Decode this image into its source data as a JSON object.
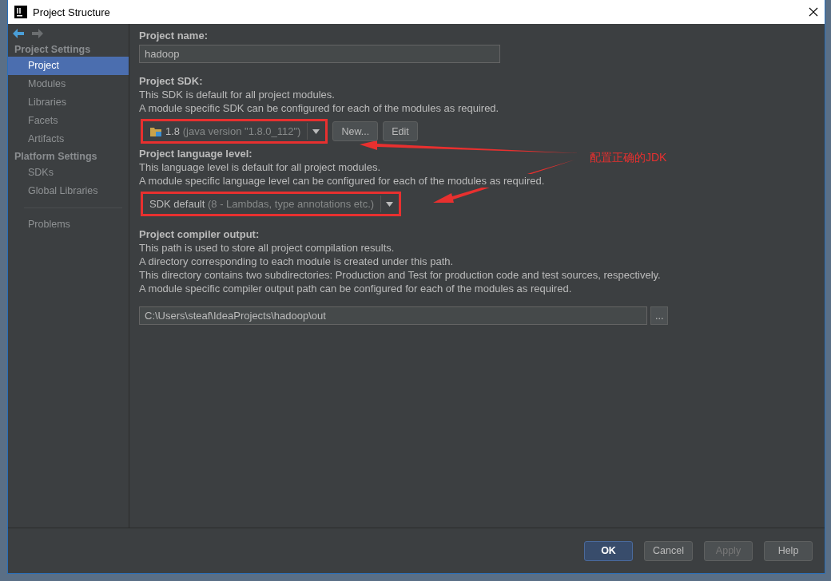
{
  "window": {
    "title": "Project Structure"
  },
  "sidebar": {
    "groups": [
      {
        "title": "Project Settings",
        "items": [
          {
            "label": "Project",
            "selected": true
          },
          {
            "label": "Modules",
            "selected": false
          },
          {
            "label": "Libraries",
            "selected": false
          },
          {
            "label": "Facets",
            "selected": false
          },
          {
            "label": "Artifacts",
            "selected": false
          }
        ]
      },
      {
        "title": "Platform Settings",
        "items": [
          {
            "label": "SDKs",
            "selected": false
          },
          {
            "label": "Global Libraries",
            "selected": false
          }
        ]
      }
    ],
    "extra_items": [
      {
        "label": "Problems",
        "selected": false
      }
    ]
  },
  "project_name": {
    "label": "Project name:",
    "value": "hadoop"
  },
  "project_sdk": {
    "label": "Project SDK:",
    "description": [
      "This SDK is default for all project modules.",
      "A module specific SDK can be configured for each of the modules as required."
    ],
    "combo": {
      "value": "1.8",
      "detail": "(java version \"1.8.0_112\")",
      "highlighted": true
    },
    "buttons": [
      "New...",
      "Edit"
    ]
  },
  "language_level": {
    "label": "Project language level:",
    "description": [
      "This language level is default for all project modules.",
      "A module specific language level can be configured for each of the modules as required."
    ],
    "combo": {
      "value": "SDK default",
      "detail": "(8 - Lambdas, type annotations etc.)",
      "highlighted": true
    }
  },
  "compiler_output": {
    "label": "Project compiler output:",
    "description": [
      "This path is used to store all project compilation results.",
      "A directory corresponding to each module is created under this path.",
      "This directory contains two subdirectories: Production and Test for production code and test sources, respectively.",
      "A module specific compiler output path can be configured for each of the modules as required."
    ],
    "value": "C:\\Users\\steaf\\IdeaProjects\\hadoop\\out",
    "browse_button": "..."
  },
  "annotation": {
    "text": "配置正确的JDK"
  },
  "buttons": [
    {
      "label": "OK",
      "default": true,
      "disabled": false
    },
    {
      "label": "Cancel",
      "default": false,
      "disabled": false
    },
    {
      "label": "Apply",
      "default": false,
      "disabled": true
    },
    {
      "label": "Help",
      "default": false,
      "disabled": false
    }
  ]
}
